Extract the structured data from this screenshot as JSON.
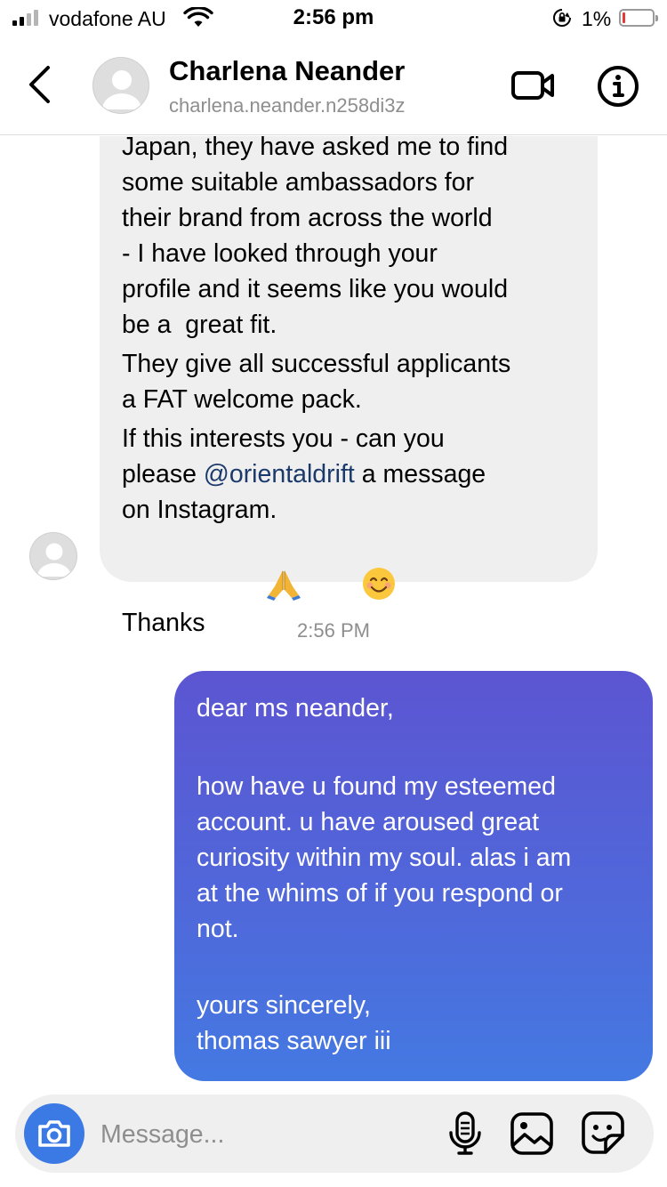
{
  "status_bar": {
    "carrier": "vodafone AU",
    "time": "2:56 pm",
    "battery": "1%",
    "battery_level": 0.01
  },
  "header": {
    "name": "Charlena Neander",
    "username": "charlena.neander.n258di3z"
  },
  "thread": {
    "incoming": {
      "paragraph1": "Japan, they have asked me to find\nsome suitable ambassadors for\ntheir brand from across the world\n- I have looked through your\nprofile and it seems like you would\nbe a  great fit.",
      "paragraph2": "They give all successful applicants\na FAT welcome pack.",
      "paragraph3_pre": "If this interests you - can you\nplease ",
      "mention": "@orientaldrift",
      "paragraph3_post": " a message\non Instagram.",
      "thanks": "Thanks"
    },
    "timestamp": "2:56 PM",
    "outgoing": {
      "greeting": "dear ms neander,",
      "body": "how have u found my esteemed\naccount. u have aroused great\ncuriosity within my soul. alas i am\nat the whims of if you respond or\nnot.",
      "closing": "yours sincerely,",
      "signature": "thomas sawyer iii"
    }
  },
  "composer": {
    "placeholder": "Message..."
  },
  "colors": {
    "outgoing_top": "#5c55d2",
    "outgoing_bottom": "#4479e2",
    "incoming_bg": "#efefef",
    "camera_button": "#3b79e5",
    "mention": "#1b3a6b"
  },
  "icons": [
    "back-chevron-icon",
    "video-call-icon",
    "info-icon",
    "camera-icon",
    "microphone-icon",
    "gallery-icon",
    "sticker-icon",
    "folded-hands-emoji",
    "smiling-face-emoji"
  ]
}
